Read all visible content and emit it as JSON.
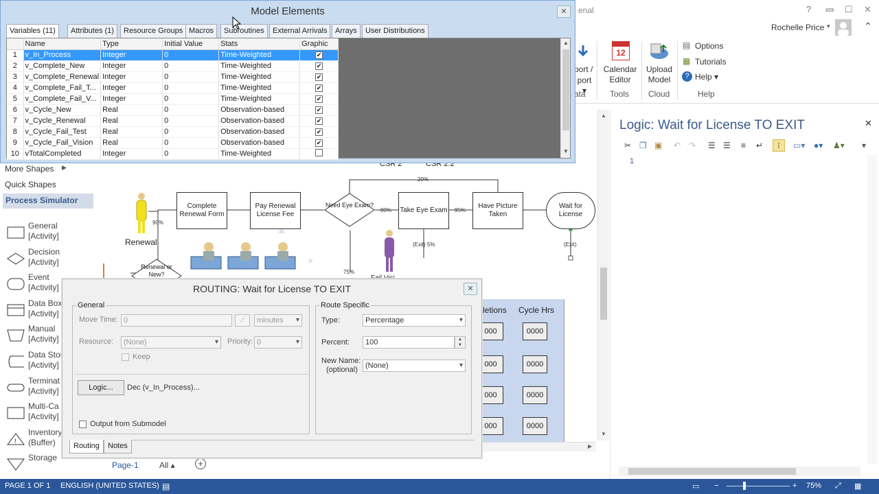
{
  "app": {
    "user_name": "Rochelle Price",
    "logic_title": "Logic: Wait for License TO EXIT",
    "logic_line_number": "1",
    "partial_title": "enal"
  },
  "ribbon": {
    "groups": [
      {
        "buttons": [
          "port /",
          "port ▾"
        ],
        "label": "ata"
      },
      {
        "buttons": [
          "Calendar Editor"
        ],
        "label": "Tools"
      },
      {
        "buttons": [
          "Upload Model"
        ],
        "label": "Cloud"
      },
      {
        "buttons": [
          "Options",
          "Tutorials",
          "Help ▾"
        ],
        "label": "Help"
      }
    ]
  },
  "shapes_pane": {
    "headers": [
      "More Shapes",
      "Quick Shapes",
      "Process Simulator"
    ],
    "items": [
      {
        "name": "General",
        "sub": "[Activity]"
      },
      {
        "name": "Decision",
        "sub": "[Activity]"
      },
      {
        "name": "Event",
        "sub": "[Activity]"
      },
      {
        "name": "Data Box",
        "sub": "[Activity]"
      },
      {
        "name": "Manual",
        "sub": "[Activity]"
      },
      {
        "name": "Data Stor",
        "sub": "[Activity]"
      },
      {
        "name": "Terminat",
        "sub": "[Activity]"
      },
      {
        "name": "Multi-Ca",
        "sub": "[Activity]"
      },
      {
        "name": "Inventory",
        "sub": "(Buffer)"
      },
      {
        "name": "Storage",
        "sub": ""
      }
    ]
  },
  "flow": {
    "renewal_label": "Renewal",
    "renewal_pct": "90%",
    "boxes": [
      "Complete Renewal Form",
      "Pay Renewal License Fee",
      "Need Eye Exam?",
      "Take Eye Exam",
      "Have Picture Taken",
      "Wait for License"
    ],
    "top_labels": [
      "CSR 2",
      "CSR 2.2"
    ],
    "pct_labels": [
      "20%",
      "80%",
      "95%",
      "75%"
    ],
    "exit_labels": [
      "(Exit) 5%",
      "(Exit)"
    ],
    "decision_label": "Renewal or New?",
    "fail_label": "Fail Visi"
  },
  "model_elements": {
    "title": "Model Elements",
    "tabs": [
      "Variables (11)",
      "Attributes (1)",
      "Resource Groups",
      "Macros",
      "Subroutines",
      "External Arrivals",
      "Arrays",
      "User Distributions"
    ],
    "columns": [
      "Name",
      "Type",
      "Initial Value",
      "Stats",
      "Graphic"
    ],
    "rows": [
      {
        "n": "1",
        "name": "v_In_Process",
        "type": "Integer",
        "init": "0",
        "stats": "Time-Weighted",
        "graphic": "✔"
      },
      {
        "n": "2",
        "name": "v_Complete_New",
        "type": "Integer",
        "init": "0",
        "stats": "Time-Weighted",
        "graphic": "✔"
      },
      {
        "n": "3",
        "name": "v_Complete_Renewal",
        "type": "Integer",
        "init": "0",
        "stats": "Time-Weighted",
        "graphic": "✔"
      },
      {
        "n": "4",
        "name": "v_Complete_Fail_T...",
        "type": "Integer",
        "init": "0",
        "stats": "Time-Weighted",
        "graphic": "✔"
      },
      {
        "n": "5",
        "name": "v_Complete_Fail_V...",
        "type": "Integer",
        "init": "0",
        "stats": "Time-Weighted",
        "graphic": "✔"
      },
      {
        "n": "6",
        "name": "v_Cycle_New",
        "type": "Real",
        "init": "0",
        "stats": "Observation-based",
        "graphic": "✔"
      },
      {
        "n": "7",
        "name": "v_Cycle_Renewal",
        "type": "Real",
        "init": "0",
        "stats": "Observation-based",
        "graphic": "✔"
      },
      {
        "n": "8",
        "name": "v_Cycle_Fail_Test",
        "type": "Real",
        "init": "0",
        "stats": "Observation-based",
        "graphic": "✔"
      },
      {
        "n": "9",
        "name": "v_Cycle_Fail_Vision",
        "type": "Real",
        "init": "0",
        "stats": "Observation-based",
        "graphic": "✔"
      },
      {
        "n": "10",
        "name": "vTotalCompleted",
        "type": "Integer",
        "init": "0",
        "stats": "Time-Weighted",
        "graphic": ""
      }
    ]
  },
  "routing": {
    "title": "ROUTING: Wait for License TO EXIT",
    "general_label": "General",
    "move_time_label": "Move Time:",
    "move_time_value": "0",
    "move_time_unit": "minutes",
    "resource_label": "Resource:",
    "resource_value": "(None)",
    "priority_label": "Priority:",
    "priority_value": "0",
    "keep_label": "Keep",
    "logic_button": "Logic...",
    "logic_text": "Dec (v_In_Process)...",
    "output_label": "Output from Submodel",
    "route_specific_label": "Route Specific",
    "type_label": "Type:",
    "type_value": "Percentage",
    "percent_label": "Percent:",
    "percent_value": "100",
    "new_name_label": "New Name:",
    "new_name_sub": "(optional)",
    "new_name_value": "(None)",
    "tabs": [
      "Routing",
      "Notes"
    ]
  },
  "stats_panel": {
    "headers": [
      "letions",
      "Cycle Hrs"
    ],
    "cells": [
      "000",
      "0000",
      "000",
      "0000",
      "000",
      "0000",
      "000",
      "0000"
    ]
  },
  "page_tabs": {
    "page": "Page-1",
    "all": "All ▴"
  },
  "status": {
    "page": "PAGE 1 OF 1",
    "language": "ENGLISH (UNITED STATES)",
    "zoom": "75%"
  }
}
